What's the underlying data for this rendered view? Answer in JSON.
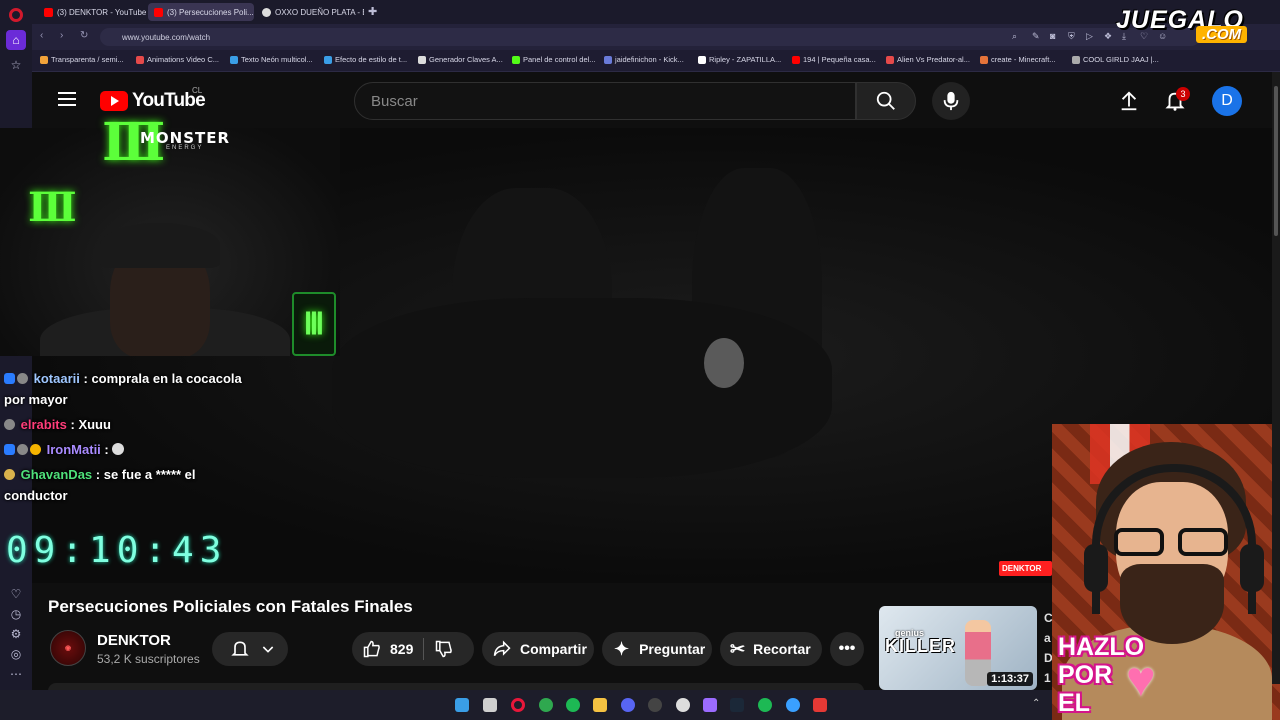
{
  "browser": {
    "tabs": [
      {
        "label": "(3) DENKTOR - YouTube",
        "color": "#ff0000"
      },
      {
        "label": "(3) Persecuciones Poli...",
        "color": "#ff0000"
      },
      {
        "label": "OXXO DUEÑO PLATA - Bu...",
        "color": "#dddddd"
      }
    ],
    "url": "www.youtube.com/watch",
    "bookmarks": [
      "Transparenta / semi...",
      "Animations Video C...",
      "Texto Neón multicol...",
      "Efecto de estilo de t...",
      "Generador Claves A...",
      "Panel de control del...",
      "jaidefinichon - Kick...",
      "Ripley - ZAPATILLA...",
      "194 | Pequeña casa...",
      "Alien Vs Predator-al...",
      "create - Minecraft...",
      "COOL GIRLD JAAJ |..."
    ]
  },
  "youtube": {
    "logo_text": "YouTube",
    "country": "CL",
    "search_placeholder": "Buscar",
    "notification_count": "3",
    "avatar_letter": "D"
  },
  "overlay": {
    "monster_brand": "MONSTER",
    "monster_sub": "ENERGY",
    "chat": [
      {
        "user": "kotaarii",
        "text": ": comprala en la cocacola por mayor"
      },
      {
        "user": "elrabits",
        "text": ": Xuuu"
      },
      {
        "user": "IronMatii",
        "text": ":"
      },
      {
        "user": "GhavanDas",
        "text": ": se fue a ***** el conductor"
      }
    ],
    "timer": "09:10:43",
    "watermark": "DENKTOR",
    "vtuber_lines": [
      "HAZLO",
      "POR",
      "EL"
    ],
    "juegalo": "JUEGALO",
    "juegalo_com": ".COM"
  },
  "video": {
    "title": "Persecuciones Policiales con Fatales Finales",
    "channel": "DENKTOR",
    "subscribers": "53,2 K suscriptores",
    "likes": "829",
    "share_label": "Compartir",
    "ask_label": "Preguntar",
    "clip_label": "Recortar"
  },
  "recommendation": {
    "thumb_small": "genius",
    "thumb_big": "KILLER",
    "duration": "1:13:37",
    "title_fragment": "C a D 1"
  }
}
